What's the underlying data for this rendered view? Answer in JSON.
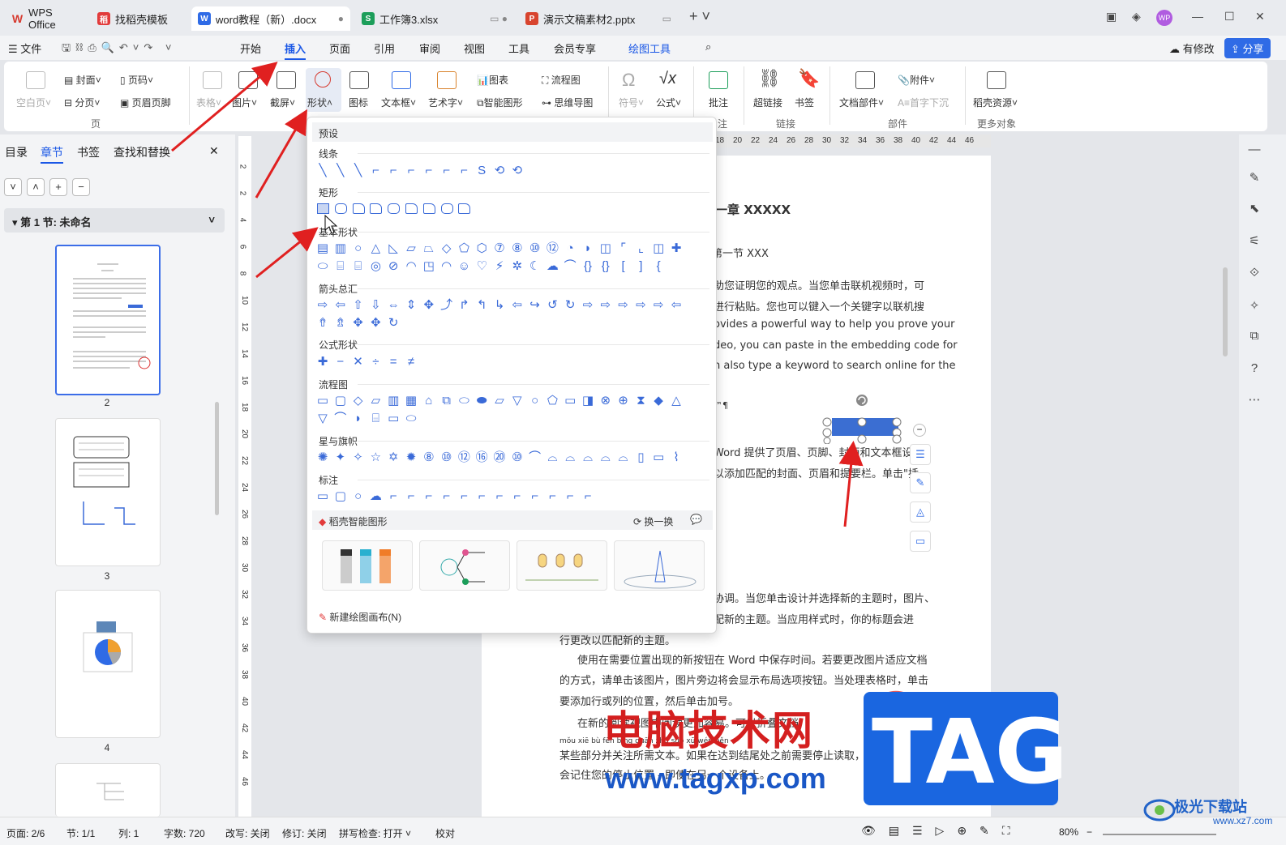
{
  "titlebar": {
    "tabs": [
      {
        "label": "WPS Office",
        "icon": "wps-logo-icon",
        "color": "#d63a2f"
      },
      {
        "label": "找稻壳模板",
        "icon": "docer-icon",
        "color": "#e23b3b"
      },
      {
        "label": "word教程（新）.docx",
        "icon": "w",
        "color": "#2f6be6"
      },
      {
        "label": "工作簿3.xlsx",
        "icon": "s",
        "color": "#1c9e5a"
      },
      {
        "label": "演示文稿素材2.pptx",
        "icon": "p",
        "color": "#d8442e"
      }
    ],
    "avatar": "WP"
  },
  "menubar": {
    "file": "文件",
    "items": [
      "开始",
      "插入",
      "页面",
      "引用",
      "审阅",
      "视图",
      "工具",
      "会员专享",
      "绘图工具"
    ],
    "active": "插入",
    "modify": "有修改",
    "share": "分享"
  },
  "ribbon": {
    "blank_page": "空白页",
    "cover": "封面",
    "page_num": "页码",
    "page_break": "分页",
    "header_footer": "页眉页脚",
    "group_page": "页",
    "table": "表格",
    "picture": "图片",
    "screenshot": "截屏",
    "shape": "形状",
    "icon": "图标",
    "textbox": "文本框",
    "art": "艺术字",
    "chart": "图表",
    "smart": "智能图形",
    "flow": "流程图",
    "mind": "思维导图",
    "symbol": "符号",
    "formula": "公式",
    "comment": "批注",
    "group_comment": "注",
    "hyperlink": "超链接",
    "bookmark": "书签",
    "group_link": "链接",
    "docpart": "文档部件",
    "dropcap": "首字下沉",
    "attach": "附件",
    "group_part": "部件",
    "docer": "稻壳资源",
    "group_more": "更多对象"
  },
  "leftpanel": {
    "tabs": [
      "目录",
      "章节",
      "书签",
      "查找和替换"
    ],
    "active": "章节",
    "section": "第 1 节: 未命名",
    "pages": [
      "2",
      "3",
      "4"
    ]
  },
  "ruler": {
    "h": [
      "18",
      "20",
      "22",
      "24",
      "26",
      "28",
      "30",
      "32",
      "34",
      "36",
      "38",
      "40",
      "42",
      "44",
      "46"
    ],
    "v": [
      "2",
      "2",
      "4",
      "6",
      "8",
      "10",
      "12",
      "14",
      "16",
      "18",
      "20",
      "22",
      "24",
      "26",
      "28",
      "30",
      "32",
      "34",
      "36",
      "38",
      "40",
      "42",
      "44",
      "46"
    ]
  },
  "document": {
    "line1": "一章 XXXXX",
    "line2": "第一节 XXX",
    "p1": [
      "助您证明您的观点。当您单击联机视频时，可",
      "进行粘贴。您也可以键入一个关键字以联机搜",
      "ovides a powerful way to help you prove your",
      "deo, you can paste in the embedding code for",
      "n also type a keyword to search online for the"
    ],
    "misc": "™¶",
    "p2": [
      "Word 提供了页眉、页脚、封面和文本框设计",
      "以添加匹配的封面、页眉和提要栏。单击\"插"
    ],
    "p3": [
      "协调。当您单击设计并选择新的主题时，图片、",
      "配新的主题。当应用样式时，你的标题会进",
      "行更改以匹配新的主题。",
      "使用在需要位置出现的新按钮在 Word 中保存时间。若要更改图片适应文档",
      "的方式，请单击该图片，图片旁边将会显示布局选项按钮。当处理表格时，单击",
      "要添加行或列的位置，然后单击加号。",
      "在新的阅读视图中阅读更加容易。可以折叠文档",
      "mǒu xiē bù fēn bìng guān zhù suǒ xū wén běn",
      "某些部分并关注所需文本。如果在达到结尾处之前需要停止读取，Word",
      "会记住您的停止位置 - 即使在另一个设备上。"
    ]
  },
  "dropdown": {
    "preset": "预设",
    "sections": [
      "线条",
      "矩形",
      "基本形状",
      "箭头总汇",
      "公式形状",
      "流程图",
      "星与旗帜",
      "标注"
    ],
    "smart_title": "稻壳智能图形",
    "refresh": "换一换",
    "new_canvas": "新建绘图画布(N)"
  },
  "statusbar": {
    "page": "页面: 2/6",
    "section": "节: 1/1",
    "col": "列: 1",
    "words": "字数: 720",
    "rewrite": "改写: 关闭",
    "revise": "修订: 关闭",
    "spell": "拼写检查: 打开",
    "proof": "校对",
    "zoom": "80%"
  },
  "watermark": {
    "cn": "电脑技术网",
    "url": "www.tagxp.com",
    "tag": "TAG",
    "corner": "极光下载站",
    "corner_url": "www.xz7.com"
  },
  "colors": {
    "accent": "#1a57e6",
    "shape_blue": "#3a6ad8",
    "annotation_red": "#e02020"
  }
}
